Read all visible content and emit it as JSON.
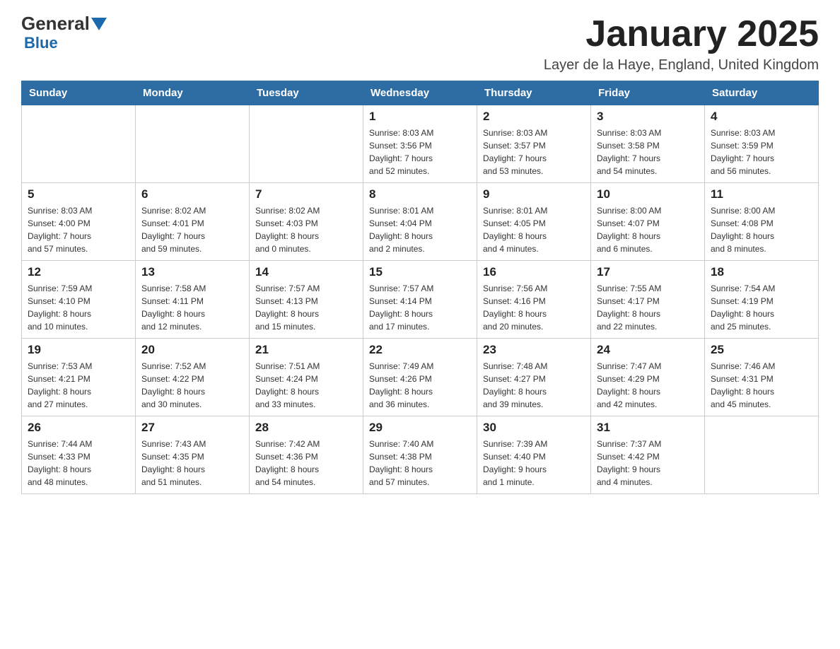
{
  "header": {
    "logo_line1": "General",
    "logo_line2": "Blue",
    "month_title": "January 2025",
    "location": "Layer de la Haye, England, United Kingdom"
  },
  "days_of_week": [
    "Sunday",
    "Monday",
    "Tuesday",
    "Wednesday",
    "Thursday",
    "Friday",
    "Saturday"
  ],
  "weeks": [
    [
      {
        "day": "",
        "info": ""
      },
      {
        "day": "",
        "info": ""
      },
      {
        "day": "",
        "info": ""
      },
      {
        "day": "1",
        "info": "Sunrise: 8:03 AM\nSunset: 3:56 PM\nDaylight: 7 hours\nand 52 minutes."
      },
      {
        "day": "2",
        "info": "Sunrise: 8:03 AM\nSunset: 3:57 PM\nDaylight: 7 hours\nand 53 minutes."
      },
      {
        "day": "3",
        "info": "Sunrise: 8:03 AM\nSunset: 3:58 PM\nDaylight: 7 hours\nand 54 minutes."
      },
      {
        "day": "4",
        "info": "Sunrise: 8:03 AM\nSunset: 3:59 PM\nDaylight: 7 hours\nand 56 minutes."
      }
    ],
    [
      {
        "day": "5",
        "info": "Sunrise: 8:03 AM\nSunset: 4:00 PM\nDaylight: 7 hours\nand 57 minutes."
      },
      {
        "day": "6",
        "info": "Sunrise: 8:02 AM\nSunset: 4:01 PM\nDaylight: 7 hours\nand 59 minutes."
      },
      {
        "day": "7",
        "info": "Sunrise: 8:02 AM\nSunset: 4:03 PM\nDaylight: 8 hours\nand 0 minutes."
      },
      {
        "day": "8",
        "info": "Sunrise: 8:01 AM\nSunset: 4:04 PM\nDaylight: 8 hours\nand 2 minutes."
      },
      {
        "day": "9",
        "info": "Sunrise: 8:01 AM\nSunset: 4:05 PM\nDaylight: 8 hours\nand 4 minutes."
      },
      {
        "day": "10",
        "info": "Sunrise: 8:00 AM\nSunset: 4:07 PM\nDaylight: 8 hours\nand 6 minutes."
      },
      {
        "day": "11",
        "info": "Sunrise: 8:00 AM\nSunset: 4:08 PM\nDaylight: 8 hours\nand 8 minutes."
      }
    ],
    [
      {
        "day": "12",
        "info": "Sunrise: 7:59 AM\nSunset: 4:10 PM\nDaylight: 8 hours\nand 10 minutes."
      },
      {
        "day": "13",
        "info": "Sunrise: 7:58 AM\nSunset: 4:11 PM\nDaylight: 8 hours\nand 12 minutes."
      },
      {
        "day": "14",
        "info": "Sunrise: 7:57 AM\nSunset: 4:13 PM\nDaylight: 8 hours\nand 15 minutes."
      },
      {
        "day": "15",
        "info": "Sunrise: 7:57 AM\nSunset: 4:14 PM\nDaylight: 8 hours\nand 17 minutes."
      },
      {
        "day": "16",
        "info": "Sunrise: 7:56 AM\nSunset: 4:16 PM\nDaylight: 8 hours\nand 20 minutes."
      },
      {
        "day": "17",
        "info": "Sunrise: 7:55 AM\nSunset: 4:17 PM\nDaylight: 8 hours\nand 22 minutes."
      },
      {
        "day": "18",
        "info": "Sunrise: 7:54 AM\nSunset: 4:19 PM\nDaylight: 8 hours\nand 25 minutes."
      }
    ],
    [
      {
        "day": "19",
        "info": "Sunrise: 7:53 AM\nSunset: 4:21 PM\nDaylight: 8 hours\nand 27 minutes."
      },
      {
        "day": "20",
        "info": "Sunrise: 7:52 AM\nSunset: 4:22 PM\nDaylight: 8 hours\nand 30 minutes."
      },
      {
        "day": "21",
        "info": "Sunrise: 7:51 AM\nSunset: 4:24 PM\nDaylight: 8 hours\nand 33 minutes."
      },
      {
        "day": "22",
        "info": "Sunrise: 7:49 AM\nSunset: 4:26 PM\nDaylight: 8 hours\nand 36 minutes."
      },
      {
        "day": "23",
        "info": "Sunrise: 7:48 AM\nSunset: 4:27 PM\nDaylight: 8 hours\nand 39 minutes."
      },
      {
        "day": "24",
        "info": "Sunrise: 7:47 AM\nSunset: 4:29 PM\nDaylight: 8 hours\nand 42 minutes."
      },
      {
        "day": "25",
        "info": "Sunrise: 7:46 AM\nSunset: 4:31 PM\nDaylight: 8 hours\nand 45 minutes."
      }
    ],
    [
      {
        "day": "26",
        "info": "Sunrise: 7:44 AM\nSunset: 4:33 PM\nDaylight: 8 hours\nand 48 minutes."
      },
      {
        "day": "27",
        "info": "Sunrise: 7:43 AM\nSunset: 4:35 PM\nDaylight: 8 hours\nand 51 minutes."
      },
      {
        "day": "28",
        "info": "Sunrise: 7:42 AM\nSunset: 4:36 PM\nDaylight: 8 hours\nand 54 minutes."
      },
      {
        "day": "29",
        "info": "Sunrise: 7:40 AM\nSunset: 4:38 PM\nDaylight: 8 hours\nand 57 minutes."
      },
      {
        "day": "30",
        "info": "Sunrise: 7:39 AM\nSunset: 4:40 PM\nDaylight: 9 hours\nand 1 minute."
      },
      {
        "day": "31",
        "info": "Sunrise: 7:37 AM\nSunset: 4:42 PM\nDaylight: 9 hours\nand 4 minutes."
      },
      {
        "day": "",
        "info": ""
      }
    ]
  ]
}
